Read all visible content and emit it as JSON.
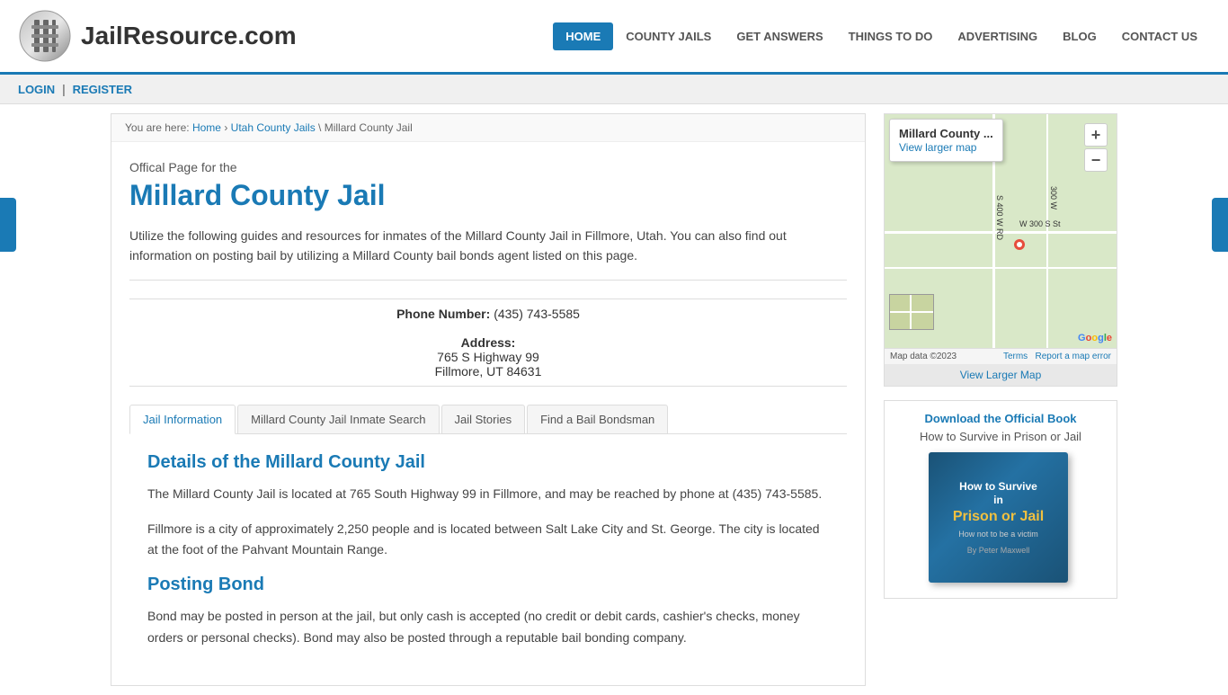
{
  "site": {
    "logo_text": "JailResource.com",
    "title": "JailResource.com"
  },
  "nav": {
    "items": [
      {
        "label": "HOME",
        "active": true
      },
      {
        "label": "COUNTY JAILS",
        "active": false
      },
      {
        "label": "GET ANSWERS",
        "active": false
      },
      {
        "label": "THINGS TO DO",
        "active": false
      },
      {
        "label": "ADVERTISING",
        "active": false
      },
      {
        "label": "BLOG",
        "active": false
      },
      {
        "label": "CONTACT US",
        "active": false
      }
    ]
  },
  "login_bar": {
    "login": "LOGIN",
    "separator": "|",
    "register": "REGISTER"
  },
  "breadcrumb": {
    "prefix": "You are here:",
    "home": "Home",
    "parent": "Utah County Jails",
    "current": "Millard County Jail"
  },
  "page": {
    "official_label": "Offical Page for the",
    "title": "Millard County Jail",
    "description": "Utilize the following guides and resources for inmates of the Millard County Jail in Fillmore, Utah. You can also find out information on posting bail by utilizing a Millard County bail bonds agent listed on this page.",
    "phone_label": "Phone Number:",
    "phone": "(435) 743-5585",
    "address_label": "Address:",
    "address_line1": "765 S Highway 99",
    "address_line2": "Fillmore, UT 84631"
  },
  "tabs": [
    {
      "label": "Jail Information",
      "active": true
    },
    {
      "label": "Millard County Jail Inmate Search",
      "active": false
    },
    {
      "label": "Jail Stories",
      "active": false
    },
    {
      "label": "Find a Bail Bondsman",
      "active": false
    }
  ],
  "tab_content": {
    "details_title": "Details of the Millard County Jail",
    "details_body1": "The Millard County Jail is located at 765 South Highway 99 in Fillmore, and may be reached by phone at (435) 743-5585.",
    "details_body2": "Fillmore is a city of approximately 2,250 people and is located between Salt Lake City and St. George. The city is located at the foot of the Pahvant Mountain Range.",
    "posting_bond_title": "Posting Bond",
    "posting_bond_body": "Bond may be posted in person at the jail, but only cash is accepted (no credit or debit cards, cashier's checks, money orders or personal checks). Bond may also be posted through a reputable bail bonding company."
  },
  "map": {
    "popup_title": "Millard County ...",
    "popup_link": "View larger map",
    "street1": "S 400 W RD",
    "street2": "W 300 S St",
    "street3": "300 W",
    "map_data": "Map data ©2023",
    "terms": "Terms",
    "report": "Report a map error",
    "view_larger": "View Larger Map"
  },
  "sidebar_book": {
    "download_link": "Download the Official Book",
    "subtitle": "How to Survive in Prison or Jail",
    "book_title_line1": "How to Survive",
    "book_title_line2": "in",
    "book_title_big": "Prison or Jail",
    "book_sub": "How not to be a victim",
    "book_author": "By Peter Maxwell"
  }
}
